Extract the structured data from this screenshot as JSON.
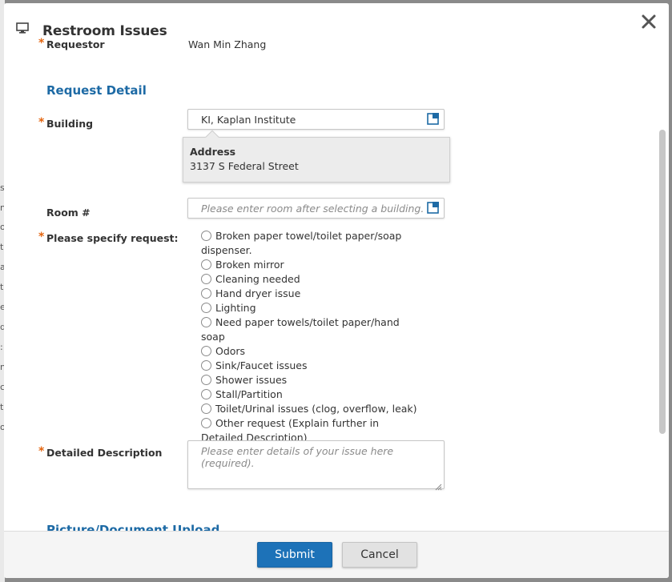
{
  "dialog": {
    "title": "Restroom Issues",
    "close_symbol": "✕"
  },
  "background": {
    "letters": [
      "s",
      "n",
      "o",
      "t",
      "a",
      "t",
      "e",
      "d",
      ":",
      "n",
      "c",
      "t",
      "o"
    ]
  },
  "form": {
    "required_mark": "*",
    "requestor": {
      "label": "Requestor",
      "value": "Wan Min Zhang"
    },
    "request_detail_heading": "Request Detail",
    "building": {
      "label": "Building",
      "value": "KI, Kaplan Institute",
      "address_label": "Address",
      "address_value": "3137 S Federal Street"
    },
    "room": {
      "label": "Room #",
      "placeholder": "Please enter room after selecting a building."
    },
    "request_type": {
      "label": "Please specify request:",
      "options": [
        "Broken paper towel/toilet paper/soap dispenser.",
        "Broken mirror",
        "Cleaning needed",
        "Hand dryer issue",
        "Lighting",
        "Need paper towels/toilet paper/hand soap",
        "Odors",
        "Sink/Faucet issues",
        "Shower issues",
        "Stall/Partition",
        "Toilet/Urinal issues (clog, overflow, leak)",
        "Other request (Explain further in Detailed Description)"
      ]
    },
    "description": {
      "label": "Detailed Description",
      "placeholder": "Please enter details of your issue here (required)."
    },
    "upload_heading": "Picture/Document Upload"
  },
  "footer": {
    "submit_label": "Submit",
    "cancel_label": "Cancel"
  },
  "colors": {
    "accent": "#1d6aa5",
    "required": "#e4650f",
    "submit_bg": "#1d72b8"
  }
}
